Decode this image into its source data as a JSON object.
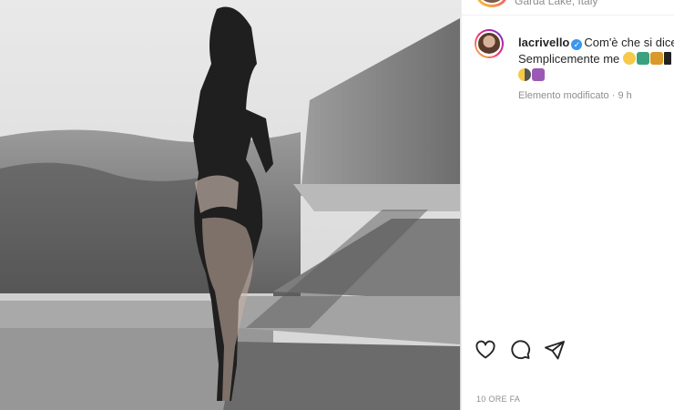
{
  "post": {
    "location": "Garda Lake, Italy",
    "username": "lacrivello",
    "verified_mark": "✓",
    "caption_line1": "Com'è che si dice?",
    "caption_line2": "Semplicemente me",
    "edited_label": "Elemento modificato",
    "edited_separator": "·",
    "edited_time": "9 h",
    "timestamp": "10 ORE FA"
  },
  "icons": [
    "heart-icon",
    "comment-icon",
    "share-icon"
  ],
  "colors": {
    "verified": "#3897f0",
    "muted": "#8e8e8e",
    "text": "#262626"
  }
}
